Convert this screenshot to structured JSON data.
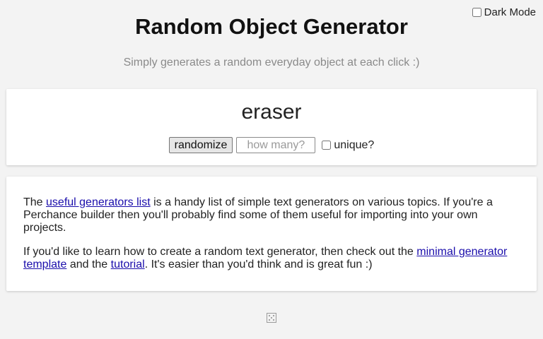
{
  "dark_mode": {
    "label": "Dark Mode",
    "checked": false
  },
  "header": {
    "title": "Random Object Generator",
    "subtitle": "Simply generates a random everyday object at each click :)"
  },
  "generator": {
    "output": "eraser",
    "randomize_label": "randomize",
    "how_many_placeholder": "how many?",
    "unique_label": "unique?"
  },
  "info": {
    "p1": {
      "before": "The ",
      "link": "useful generators list",
      "after": " is a handy list of simple text generators on various topics. If you're a Perchance builder then you'll probably find some of them useful for importing into your own projects."
    },
    "p2": {
      "before": "If you'd like to learn how to create a random text generator, then check out the ",
      "link1": "minimal generator template",
      "middle": " and the ",
      "link2": "tutorial",
      "after": ". It's easier than you'd think and is great fun :)"
    }
  },
  "footer": {
    "icon": "dice-icon"
  }
}
